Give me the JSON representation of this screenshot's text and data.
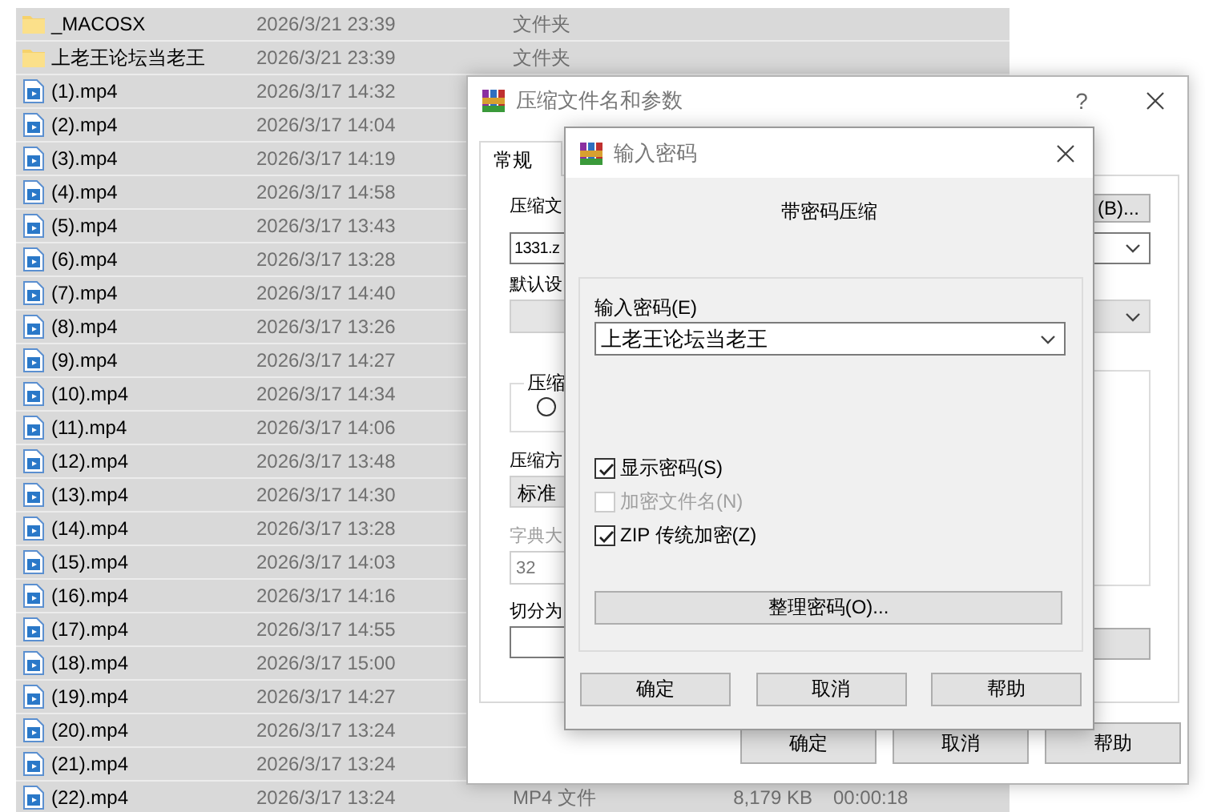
{
  "files": [
    {
      "name": "_MACOSX",
      "kind": "folder",
      "modified": "2026/3/21 23:39",
      "type": "文件夹",
      "selected": true
    },
    {
      "name": "上老王论坛当老王",
      "kind": "folder",
      "modified": "2026/3/21 23:39",
      "type": "文件夹",
      "selected": true
    },
    {
      "name": "(1).mp4",
      "kind": "video",
      "modified": "2026/3/17 14:32",
      "selected": true
    },
    {
      "name": "(2).mp4",
      "kind": "video",
      "modified": "2026/3/17 14:04",
      "selected": true
    },
    {
      "name": "(3).mp4",
      "kind": "video",
      "modified": "2026/3/17 14:19",
      "selected": true
    },
    {
      "name": "(4).mp4",
      "kind": "video",
      "modified": "2026/3/17 14:58",
      "selected": true
    },
    {
      "name": "(5).mp4",
      "kind": "video",
      "modified": "2026/3/17 13:43",
      "selected": true
    },
    {
      "name": "(6).mp4",
      "kind": "video",
      "modified": "2026/3/17 13:28",
      "selected": true
    },
    {
      "name": "(7).mp4",
      "kind": "video",
      "modified": "2026/3/17 14:40",
      "selected": true
    },
    {
      "name": "(8).mp4",
      "kind": "video",
      "modified": "2026/3/17 13:26",
      "selected": true
    },
    {
      "name": "(9).mp4",
      "kind": "video",
      "modified": "2026/3/17 14:27",
      "selected": true
    },
    {
      "name": "(10).mp4",
      "kind": "video",
      "modified": "2026/3/17 14:34",
      "selected": true
    },
    {
      "name": "(11).mp4",
      "kind": "video",
      "modified": "2026/3/17 14:06",
      "selected": true
    },
    {
      "name": "(12).mp4",
      "kind": "video",
      "modified": "2026/3/17 13:48",
      "selected": true
    },
    {
      "name": "(13).mp4",
      "kind": "video",
      "modified": "2026/3/17 14:30",
      "selected": true
    },
    {
      "name": "(14).mp4",
      "kind": "video",
      "modified": "2026/3/17 13:28",
      "selected": true
    },
    {
      "name": "(15).mp4",
      "kind": "video",
      "modified": "2026/3/17 14:03",
      "selected": true
    },
    {
      "name": "(16).mp4",
      "kind": "video",
      "modified": "2026/3/17 14:16",
      "selected": true
    },
    {
      "name": "(17).mp4",
      "kind": "video",
      "modified": "2026/3/17 14:55",
      "selected": true
    },
    {
      "name": "(18).mp4",
      "kind": "video",
      "modified": "2026/3/17 15:00",
      "selected": true
    },
    {
      "name": "(19).mp4",
      "kind": "video",
      "modified": "2026/3/17 14:27",
      "selected": true
    },
    {
      "name": "(20).mp4",
      "kind": "video",
      "modified": "2026/3/17 13:24",
      "selected": true
    },
    {
      "name": "(21).mp4",
      "kind": "video",
      "modified": "2026/3/17 13:24",
      "selected": true
    },
    {
      "name": "(22).mp4",
      "kind": "video",
      "modified": "2026/3/17 13:24",
      "type": "MP4 文件",
      "size": "8,179 KB",
      "duration": "00:00:18",
      "selected": true
    }
  ],
  "archive_dialog": {
    "title": "压缩文件名和参数",
    "help": "?",
    "tabs": [
      {
        "label": "常规",
        "selected": true
      }
    ],
    "archive_name_label": "压缩文",
    "browse_button": "(B)...",
    "archive_name": "1331.z",
    "profile_label": "默认设",
    "format_group": "压缩",
    "format_radio": {
      "selected": false
    },
    "method_label": "压缩方",
    "method": "标准",
    "dictionary_label": "字典大",
    "dictionary": "32",
    "dictionary_disabled": true,
    "split_label": "切分为",
    "buttons": [
      "确定",
      "取消",
      "帮助"
    ]
  },
  "password_dialog": {
    "title": "输入密码",
    "heading": "带密码压缩",
    "password_label": "输入密码(E)",
    "password": "上老王论坛当老王",
    "options": [
      {
        "label": "显示密码(S)",
        "checked": true,
        "disabled": false
      },
      {
        "label": "加密文件名(N)",
        "checked": false,
        "disabled": true
      },
      {
        "label": "ZIP 传统加密(Z)",
        "checked": true,
        "disabled": false
      }
    ],
    "manage_button": "整理密码(O)...",
    "buttons": [
      "确定",
      "取消",
      "帮助"
    ]
  }
}
